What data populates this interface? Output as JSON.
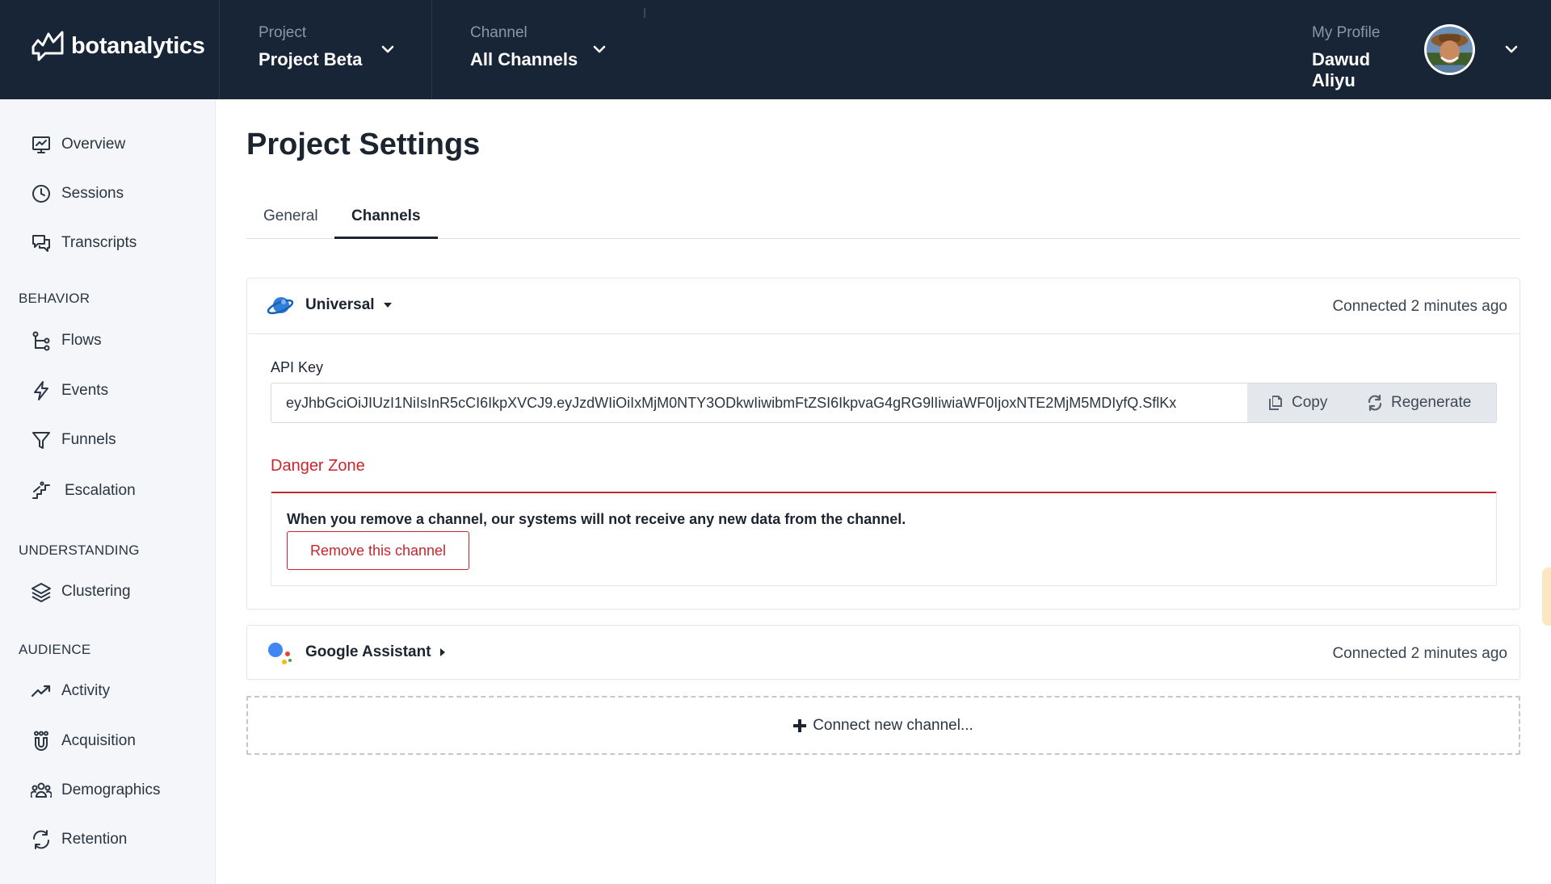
{
  "brand": {
    "name": "botanalytics"
  },
  "topbar": {
    "project": {
      "label": "Project",
      "value": "Project Beta"
    },
    "channel": {
      "label": "Channel",
      "value": "All Channels"
    },
    "profile": {
      "label": "My Profile",
      "value": "Dawud Aliyu"
    }
  },
  "sidebar": {
    "items": [
      {
        "label": "Overview",
        "icon": "overview-icon"
      },
      {
        "label": "Sessions",
        "icon": "clock-icon"
      },
      {
        "label": "Transcripts",
        "icon": "chat-icon"
      }
    ],
    "behavior": {
      "title": "BEHAVIOR",
      "items": [
        {
          "label": "Flows",
          "icon": "flows-icon"
        },
        {
          "label": "Events",
          "icon": "lightning-icon"
        },
        {
          "label": "Funnels",
          "icon": "funnel-icon"
        },
        {
          "label": "Escalation",
          "icon": "escalation-icon"
        }
      ]
    },
    "understanding": {
      "title": "UNDERSTANDING",
      "items": [
        {
          "label": "Clustering",
          "icon": "layers-icon"
        }
      ]
    },
    "audience": {
      "title": "AUDIENCE",
      "items": [
        {
          "label": "Activity",
          "icon": "trend-icon"
        },
        {
          "label": "Acquisition",
          "icon": "magnet-icon"
        },
        {
          "label": "Demographics",
          "icon": "users-icon"
        },
        {
          "label": "Retention",
          "icon": "refresh-icon"
        }
      ]
    }
  },
  "main": {
    "title": "Project Settings",
    "tabs": [
      {
        "label": "General",
        "active": false
      },
      {
        "label": "Channels",
        "active": true
      }
    ],
    "channels": [
      {
        "name": "Universal",
        "status": "Connected 2 minutes ago",
        "expanded": true,
        "api_key_label": "API Key",
        "api_key": "eyJhbGciOiJIUzI1NiIsInR5cCI6IkpXVCJ9.eyJzdWIiOiIxMjM0NTY3ODkwIiwibmFtZSI6IkpvaG4gRG9lIiwiaWF0IjoxNTE2MjM5MDIyfQ.SflKx",
        "copy_label": "Copy",
        "regenerate_label": "Regenerate",
        "danger_title": "Danger Zone",
        "danger_message": "When you remove a channel, our systems will not receive any new data from the channel.",
        "remove_label": "Remove this channel"
      },
      {
        "name": "Google Assistant",
        "status": "Connected 2 minutes ago",
        "expanded": false
      }
    ],
    "connect_new_label": "Connect new channel..."
  },
  "colors": {
    "topbar_bg": "#182536",
    "sidebar_bg": "#f4f6f9",
    "danger": "#c9252c",
    "universal_blue": "#2f7fd8",
    "google_blue": "#4285f4",
    "google_red": "#ea4335",
    "google_yellow": "#fbbc05",
    "google_green": "#34a853"
  }
}
